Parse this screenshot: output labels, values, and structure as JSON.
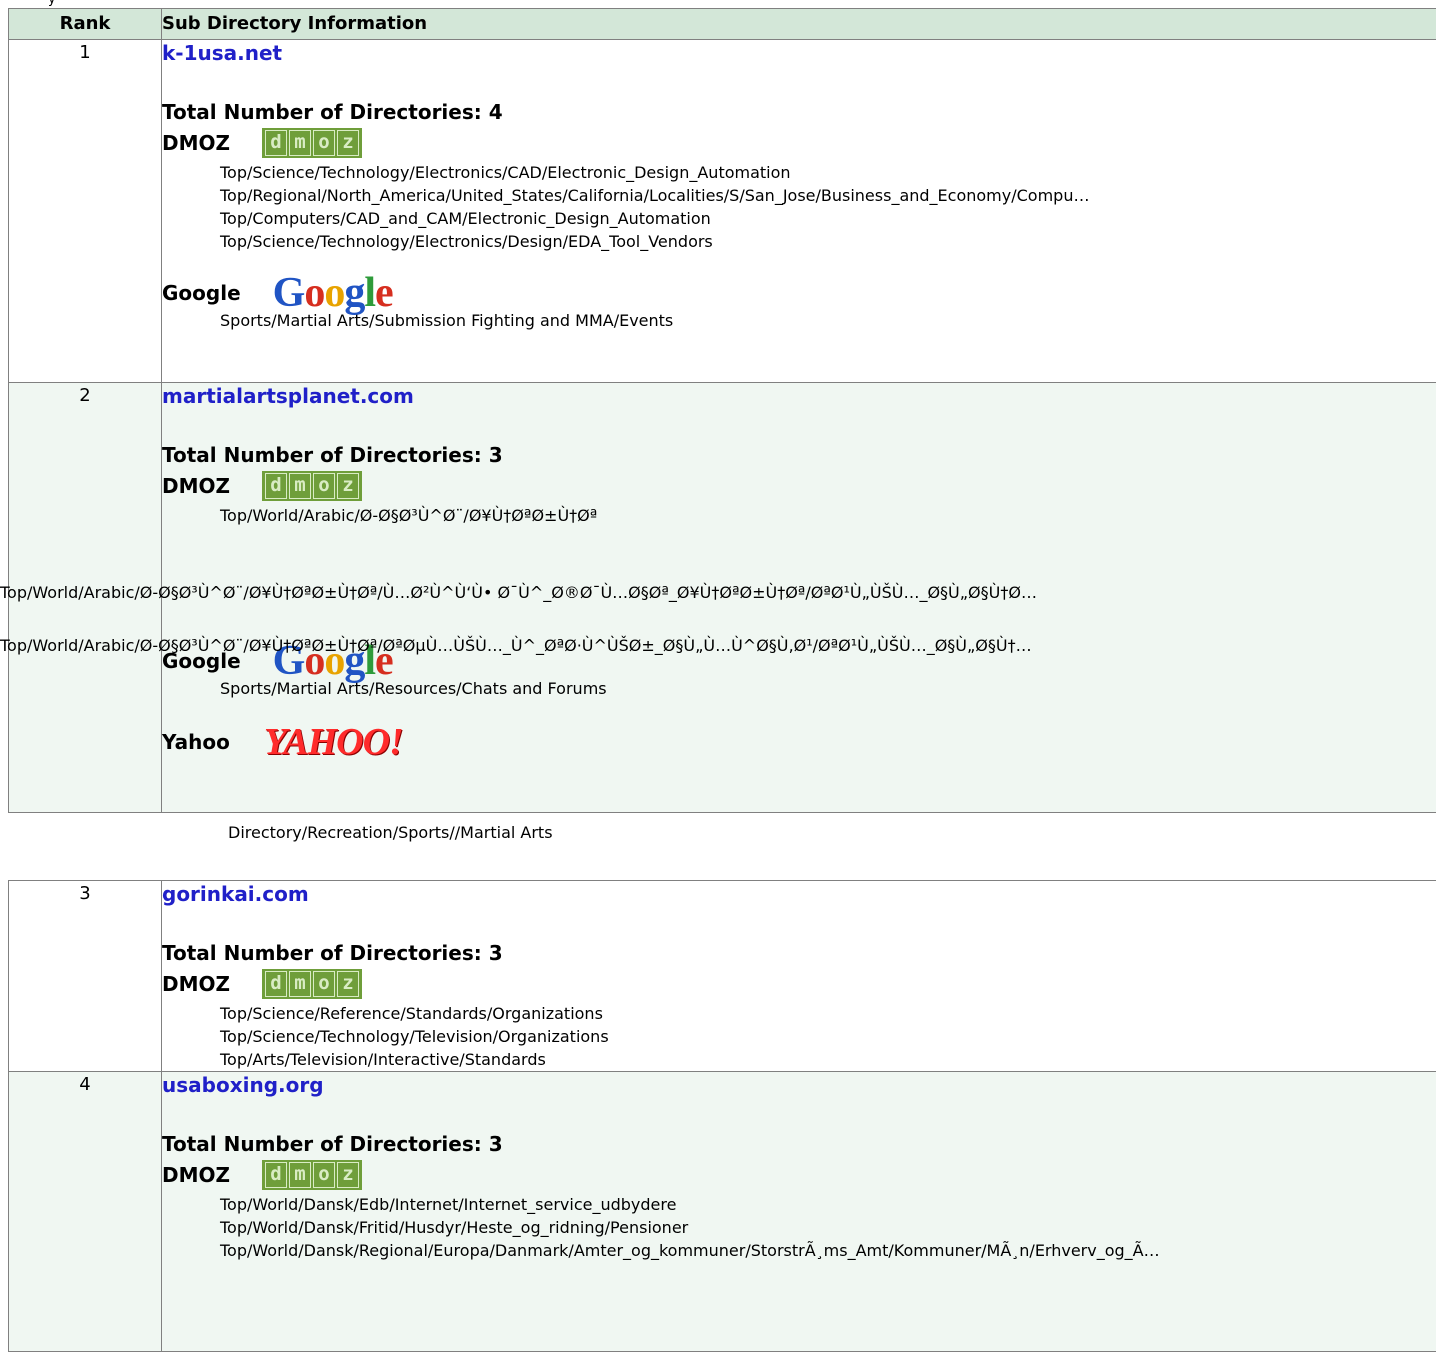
{
  "table_header": {
    "rank": "Rank",
    "info": "Sub Directory Information"
  },
  "entries": [
    {
      "rank": "1",
      "site": "k-1usa.net",
      "total": "Total Number of Directories: 4",
      "dmoz_label": "DMOZ",
      "dmoz_paths": [
        "Top/Science/Technology/Electronics/CAD/Electronic_Design_Automation",
        "Top/Regional/North_America/United_States/California/Localities/S/San_Jose/Business_and_Economy/Compu…",
        "Top/Computers/CAD_and_CAM/Electronic_Design_Automation",
        "Top/Science/Technology/Electronics/Design/EDA_Tool_Vendors"
      ],
      "google_label": "Google",
      "google_paths": [
        "Sports/Martial Arts/Submission Fighting and MMA/Events"
      ]
    },
    {
      "rank": "2",
      "site": "martialartsplanet.com",
      "total": "Total Number of Directories: 3",
      "dmoz_label": "DMOZ",
      "dmoz_paths": [
        "Top/World/Arabic/Ø-Ø§Ø³Ù^Ø¨/Ø¥Ù†ØªØ±Ù†Øª",
        "Top/World/Arabic/Ø-Ø§Ø³Ù^Ø¨/Ø¥Ù†ØªØ±Ù†Øª/Ù…Ø²Ù^Ù‘Ù• Ø¯Ù^_Ø®Ø¯Ù…Ø§Øª_Ø¥Ù†ØªØ±Ù†Øª/ØªØ¹Ù„ÙŠÙ…_Ø§Ù„Ø§Ù†Ø…",
        "Top/World/Arabic/Ø-Ø§Ø³Ù^Ø¨/Ø¥Ù†ØªØ±Ù†Øª/ØªØµÙ…ÙŠÙ…_Ù^_ØªØ·Ù^ÙŠØ±_Ø§Ù„Ù…Ù^Ø§Ù‚Ø¹/ØªØ¹Ù„ÙŠÙ…_Ø§Ù„Ø§Ù†…"
      ],
      "google_label": "Google",
      "google_paths": [
        "Sports/Martial Arts/Resources/Chats and Forums"
      ],
      "yahoo_label": "Yahoo",
      "yahoo_logo_text": "YAHOO!",
      "yahoo_paths": [
        "Directory/Recreation/Sports//Martial Arts"
      ]
    },
    {
      "rank": "3",
      "site": "gorinkai.com",
      "total": "Total Number of Directories: 3",
      "dmoz_label": "DMOZ",
      "dmoz_paths": [
        "Top/Science/Reference/Standards/Organizations",
        "Top/Science/Technology/Television/Organizations",
        "Top/Arts/Television/Interactive/Standards"
      ]
    },
    {
      "rank": "4",
      "site": "usaboxing.org",
      "total": "Total Number of Directories: 3",
      "dmoz_label": "DMOZ",
      "dmoz_paths": [
        "Top/World/Dansk/Edb/Internet/Internet_service_udbydere",
        "Top/World/Dansk/Fritid/Husdyr/Heste_og_ridning/Pensioner",
        "Top/World/Dansk/Regional/Europa/Danmark/Amter_og_kommuner/StorstrÃ¸ms_Amt/Kommuner/MÃ¸n/Erhverv_og_Ã…"
      ]
    }
  ],
  "logos": {
    "dmoz_letters": [
      "d",
      "m",
      "o",
      "z"
    ],
    "google_letters": [
      "G",
      "o",
      "o",
      "g",
      "l",
      "e"
    ]
  },
  "colors": {
    "header_bg": "#d3e7d8",
    "alt_row_bg": "#f0f7f2",
    "link": "#2020c8",
    "dmoz_green": "#6f9e3a",
    "yahoo_red": "#ff2b2b"
  }
}
